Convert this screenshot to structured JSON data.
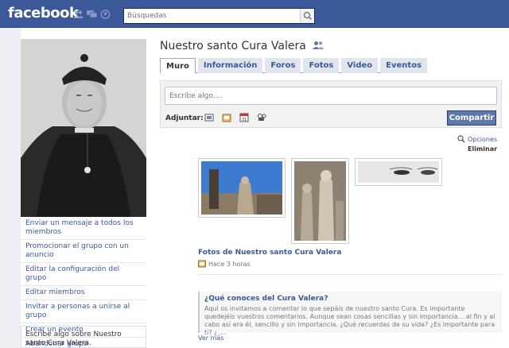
{
  "header": {
    "logo": "facebook",
    "search_placeholder": "Búsquedas"
  },
  "sidebar": {
    "links": [
      "Enviar un mensaje a todos los miembros",
      "Promocionar el grupo con un anuncio",
      "Editar la configuración del grupo",
      "Editar miembros",
      "Invitar a personas a unirse al grupo",
      "Crear un evento",
      "Abandonar grupo"
    ],
    "about": "Escribe algo sobre Nuestro santo Cura Valera."
  },
  "main": {
    "title": "Nuestro santo Cura Valera",
    "tabs": [
      "Muro",
      "Información",
      "Foros",
      "Fotos",
      "Video",
      "Eventos"
    ],
    "active_tab": "Muro",
    "composer": {
      "placeholder": "Escribe algo....",
      "attach_label": "Adjuntar:",
      "attach_icons": [
        "photo-icon",
        "link-icon",
        "event-icon",
        "video-icon"
      ],
      "share_label": "Compartir"
    },
    "options_label": "Opciones",
    "delete_label": "Eliminar",
    "photos_post": {
      "title": "Fotos de Nuestro santo Cura Valera",
      "time": "Hace 3 horas"
    },
    "discussion": {
      "title": "¿Qué conoces del Cura Valera?",
      "body": "Aquí os invitamos a comentar lo que sepáis de nuestro santo Cura. Es importante quedejéis vuestros comentarios. Aunque sean cosas sencillas y sin importancia... al fin y al cabo así era él, sencillo y sin importancia. ¿Qué recuerdas de su vida? ¿Es importante para ti? ¿ ...",
      "more": "Ver más"
    }
  },
  "colors": {
    "brand": "#3b5998",
    "share_button": "#5f78ab"
  }
}
